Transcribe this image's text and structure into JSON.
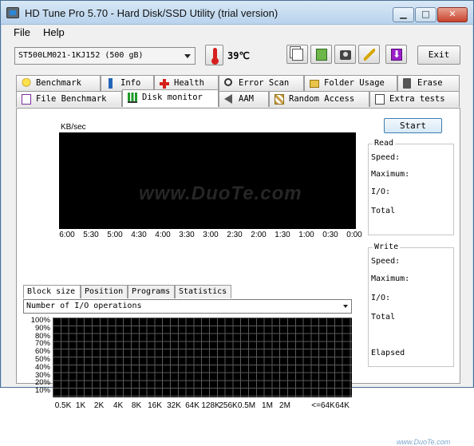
{
  "window": {
    "title": "HD Tune Pro 5.70 - Hard Disk/SSD Utility (trial version)",
    "minimize_glyph": "▁",
    "maximize_glyph": "□",
    "close_glyph": "✕"
  },
  "menu": {
    "file": "File",
    "help": "Help"
  },
  "toolbar": {
    "drive": "ST500LM021-1KJ152 (500 gB)",
    "temperature": "39",
    "temperature_unit": "℃",
    "exit_label": "Exit",
    "icons": [
      "copy-info-icon",
      "copy-screenshot-icon",
      "camera-icon",
      "options-icon",
      "download-icon"
    ]
  },
  "tabs_top": [
    {
      "label": "Benchmark",
      "icon": "bulb-icon"
    },
    {
      "label": "Info",
      "icon": "info-icon"
    },
    {
      "label": "Health",
      "icon": "health-cross-icon"
    },
    {
      "label": "Error Scan",
      "icon": "magnifier-icon"
    },
    {
      "label": "Folder Usage",
      "icon": "folder-icon"
    },
    {
      "label": "Erase",
      "icon": "trash-icon"
    }
  ],
  "tabs_bottom": [
    {
      "label": "File Benchmark",
      "icon": "file-benchmark-icon"
    },
    {
      "label": "Disk monitor",
      "icon": "bar-chart-icon",
      "active": true
    },
    {
      "label": "AAM",
      "icon": "speaker-icon"
    },
    {
      "label": "Random Access",
      "icon": "random-access-icon"
    },
    {
      "label": "Extra tests",
      "icon": "extra-tests-icon"
    }
  ],
  "monitor": {
    "start_label": "Start",
    "unit_label": "KB/sec",
    "watermark": "www.DuoTe.com",
    "time_ticks": [
      "6:00",
      "5:30",
      "5:00",
      "4:30",
      "4:00",
      "3:30",
      "3:00",
      "2:30",
      "2:00",
      "1:30",
      "1:00",
      "0:30",
      "0:00"
    ]
  },
  "read_panel": {
    "title": "Read",
    "labels": [
      "Speed:",
      "Maximum:",
      "I/O:",
      "Total"
    ]
  },
  "write_panel": {
    "title": "Write",
    "labels": [
      "Speed:",
      "Maximum:",
      "I/O:",
      "Total",
      "Elapsed"
    ]
  },
  "sub_tabs": [
    "Block size",
    "Position",
    "Programs",
    "Statistics"
  ],
  "io_select": {
    "value": "Number of I/O operations"
  },
  "block_chart": {
    "y_ticks": [
      "100%",
      "90%",
      "80%",
      "70%",
      "60%",
      "50%",
      "40%",
      "30%",
      "20%",
      "10%"
    ],
    "x_ticks": [
      "0.5K",
      "1K",
      "2K",
      "4K",
      "8K",
      "16K",
      "32K",
      "64K",
      "128K",
      "256K",
      "0.5M",
      "1M",
      "2M",
      "<=64K",
      "64K"
    ]
  },
  "corner_watermark": "www.DuoTe.com",
  "colors": {
    "title_gradient_top": "#d8e8f6",
    "plot_bg": "#000000",
    "close_red": "#c7442c"
  }
}
